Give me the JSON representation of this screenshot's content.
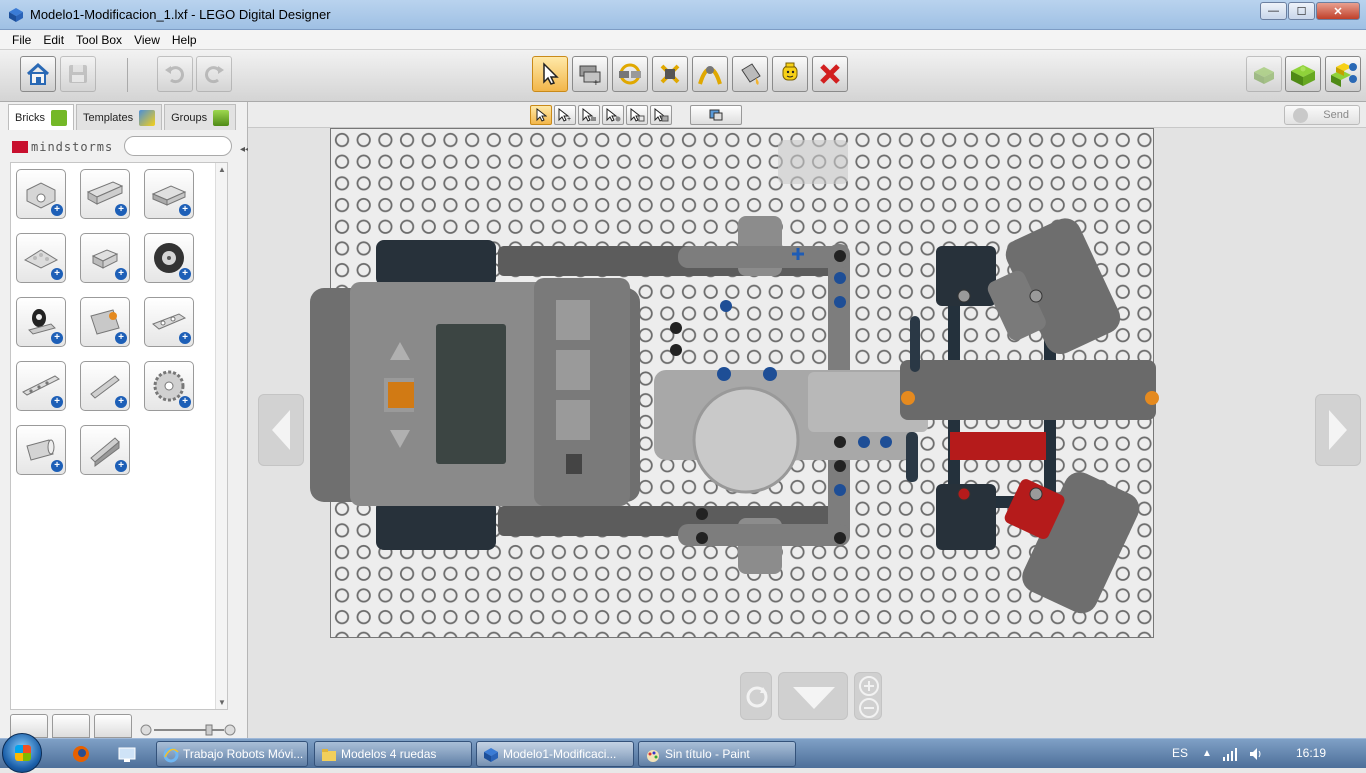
{
  "window": {
    "title": "Modelo1-Modificacion_1.lxf - LEGO Digital Designer",
    "minimize_glyph": "—",
    "maximize_glyph": "☐",
    "close_glyph": "✕"
  },
  "menu": [
    "File",
    "Edit",
    "Tool Box",
    "View",
    "Help"
  ],
  "toolbar": {
    "tools": [
      {
        "name": "select-tool",
        "icon": "arrow-cursor-icon"
      },
      {
        "name": "clone-tool",
        "icon": "clone-brick-icon"
      },
      {
        "name": "hinge-tool",
        "icon": "hinge-icon"
      },
      {
        "name": "hinge-align-tool",
        "icon": "hinge-align-icon"
      },
      {
        "name": "flex-tool",
        "icon": "flex-icon"
      },
      {
        "name": "paint-tool",
        "icon": "paint-bucket-icon"
      },
      {
        "name": "decoration-tool",
        "icon": "minifig-head-icon"
      },
      {
        "name": "delete-tool",
        "icon": "red-x-icon"
      }
    ],
    "colors": {
      "accent": "#f2b64a",
      "delete": "#d21f1f",
      "lego_green": "#74b827",
      "lego_yellow": "#f7d117"
    }
  },
  "panel": {
    "tabs": [
      {
        "label": "Bricks",
        "active": true
      },
      {
        "label": "Templates",
        "active": false
      },
      {
        "label": "Groups",
        "active": false
      }
    ],
    "brand": "MINDSTORMS",
    "brand_display": "mindstorms",
    "search_placeholder": ""
  },
  "subbar": {
    "send_label": "Send"
  },
  "taskbar": {
    "items": [
      {
        "label": "Trabajo Robots Móvi...",
        "icon": "ie-icon"
      },
      {
        "label": "Modelos 4 ruedas",
        "icon": "folder-icon"
      },
      {
        "label": "Modelo1-Modificaci...",
        "icon": "lego-icon"
      },
      {
        "label": "Sin título - Paint",
        "icon": "paint-icon"
      }
    ],
    "language": "ES",
    "time": "16:19"
  }
}
